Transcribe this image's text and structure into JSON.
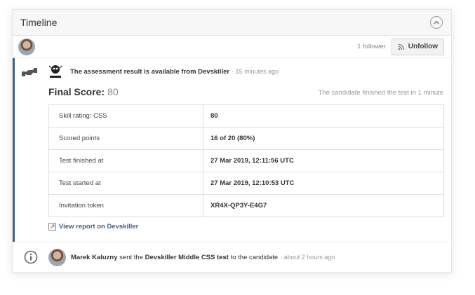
{
  "header": {
    "title": "Timeline"
  },
  "follow": {
    "followers": "1 follower",
    "unfollow_label": "Unfollow"
  },
  "event": {
    "message": "The assessment result is available from Devskiller",
    "time": "· 15 minutes ago",
    "score_label": "Final Score:",
    "score_value": "80",
    "finished_note": "The candidate finished the test in 1 minute",
    "rows": [
      {
        "key": "Skill rating: CSS",
        "value": "80"
      },
      {
        "key": "Scored points",
        "value": "16 of 20 (80%)"
      },
      {
        "key": "Test finished at",
        "value": "27 Mar 2019, 12:11:56 UTC"
      },
      {
        "key": "Test started at",
        "value": "27 Mar 2019, 12:10:53 UTC"
      },
      {
        "key": "Invitation token",
        "value": "XR4X-QP3Y-E4G7"
      }
    ],
    "report_link": "View report on Devskiller",
    "logo_caption": "devskiller"
  },
  "sent": {
    "actor": "Marek Kaluzny",
    "verb": " sent the ",
    "test_name": "Devskiller Middle CSS test",
    "suffix": " to the candidate",
    "time": "· about 2 hours ago"
  },
  "colors": {
    "accent": "#3f6186",
    "link": "#3f6186",
    "muted": "#999999"
  },
  "icons": [
    "chevron-up-icon",
    "avatar",
    "rss-icon",
    "handshake-icon",
    "devskiller-logo",
    "external-link-icon",
    "info-icon"
  ]
}
